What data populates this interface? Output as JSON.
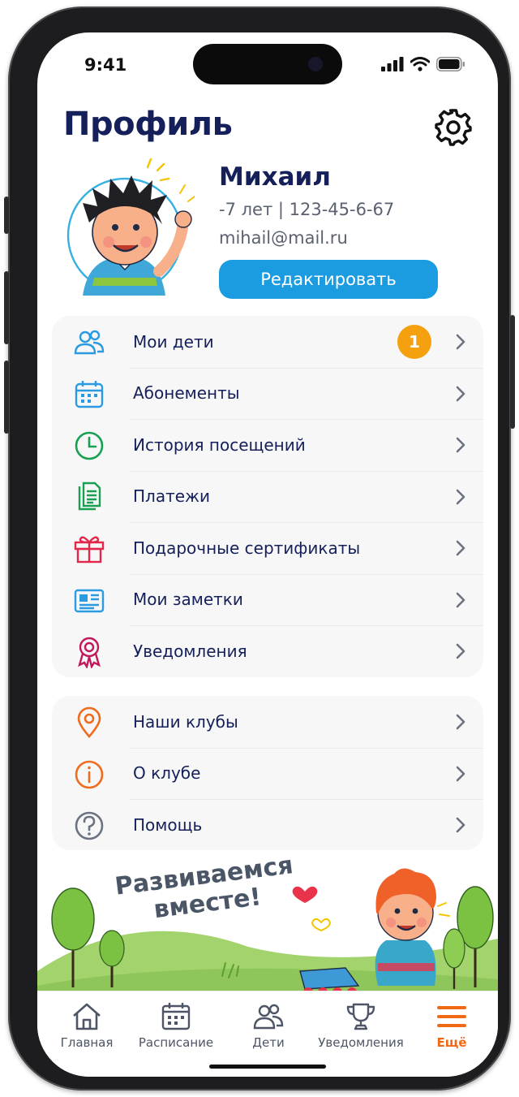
{
  "status_bar": {
    "time": "9:41"
  },
  "header": {
    "title": "Профиль"
  },
  "profile": {
    "name": "Михаил",
    "meta": "-7 лет | 123-45-6-67",
    "email": "mihail@mail.ru",
    "edit_label": "Редактировать"
  },
  "menu_main": [
    {
      "label": "Мои дети",
      "icon": "users-icon",
      "badge": "1"
    },
    {
      "label": "Абонементы",
      "icon": "calendar-icon"
    },
    {
      "label": "История посещений",
      "icon": "clock-icon"
    },
    {
      "label": "Платежи",
      "icon": "documents-icon"
    },
    {
      "label": "Подарочные сертификаты",
      "icon": "gift-icon"
    },
    {
      "label": "Мои заметки",
      "icon": "notes-icon"
    },
    {
      "label": "Уведомления",
      "icon": "award-icon"
    }
  ],
  "menu_info": [
    {
      "label": "Наши клубы",
      "icon": "location-pin-icon"
    },
    {
      "label": "О клубе",
      "icon": "info-icon"
    },
    {
      "label": "Помощь",
      "icon": "help-icon"
    }
  ],
  "banner": {
    "line1": "Развиваемся",
    "line2": "вместе!"
  },
  "tabbar": [
    {
      "label": "Главная",
      "icon": "home-icon",
      "active": false
    },
    {
      "label": "Расписание",
      "icon": "calendar-icon",
      "active": false
    },
    {
      "label": "Дети",
      "icon": "users-icon",
      "active": false
    },
    {
      "label": "Уведомления",
      "icon": "trophy-icon",
      "active": false
    },
    {
      "label": "Ещё",
      "icon": "menu-icon",
      "active": true
    }
  ],
  "colors": {
    "primary": "#1c9ce0",
    "accent": "#f06a16",
    "badge": "#f5a10f",
    "title": "#15205a"
  }
}
